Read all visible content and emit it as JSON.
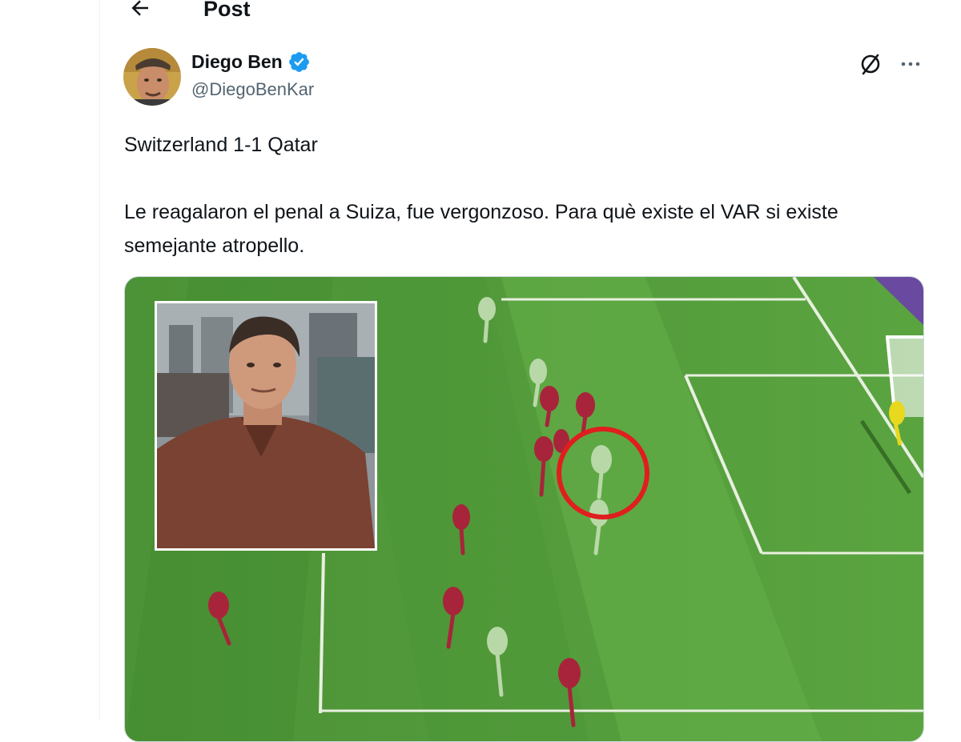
{
  "header": {
    "title": "Post",
    "back_icon": "arrow-left-icon"
  },
  "author": {
    "display_name": "Diego Ben",
    "handle": "@DiegoBenKar",
    "verified_color": "#1d9bf0"
  },
  "actions": {
    "grok_icon": "grok-icon",
    "more_icon": "more-horizontal-icon"
  },
  "tweet": {
    "line1": "Switzerland 1-1 Qatar",
    "line2": "Le reagalaron el penal a Suiza, fue vergonzoso. Para què existe el VAR si existe semejante atropello."
  },
  "media": {
    "annotation_color": "#e01e1e",
    "pitch_color": "#4f9a3a"
  }
}
